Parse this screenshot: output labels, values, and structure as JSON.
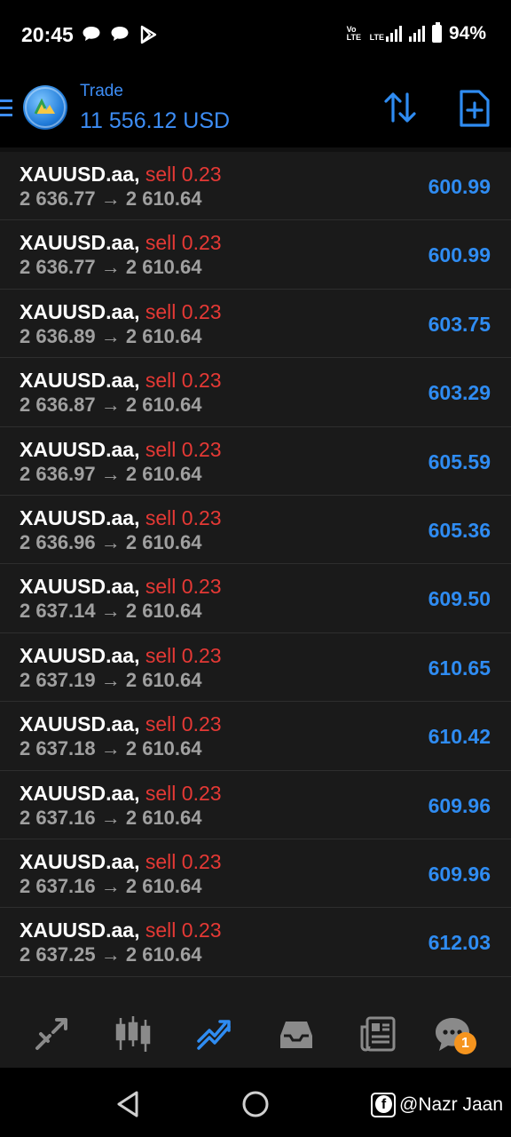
{
  "status_bar": {
    "time": "20:45",
    "volte_label": "Vo LTE",
    "lte_label": "LTE",
    "battery": "94%"
  },
  "header": {
    "title": "Trade",
    "balance": "11 556.12 USD"
  },
  "positions": [
    {
      "symbol": "XAUUSD.aa,",
      "side": "sell 0.23",
      "prices": "2 636.77 → 2 610.64",
      "profit": "600.99"
    },
    {
      "symbol": "XAUUSD.aa,",
      "side": "sell 0.23",
      "prices": "2 636.77 → 2 610.64",
      "profit": "600.99"
    },
    {
      "symbol": "XAUUSD.aa,",
      "side": "sell 0.23",
      "prices": "2 636.89 → 2 610.64",
      "profit": "603.75"
    },
    {
      "symbol": "XAUUSD.aa,",
      "side": "sell 0.23",
      "prices": "2 636.87 → 2 610.64",
      "profit": "603.29"
    },
    {
      "symbol": "XAUUSD.aa,",
      "side": "sell 0.23",
      "prices": "2 636.97 → 2 610.64",
      "profit": "605.59"
    },
    {
      "symbol": "XAUUSD.aa,",
      "side": "sell 0.23",
      "prices": "2 636.96 → 2 610.64",
      "profit": "605.36"
    },
    {
      "symbol": "XAUUSD.aa,",
      "side": "sell 0.23",
      "prices": "2 637.14 → 2 610.64",
      "profit": "609.50"
    },
    {
      "symbol": "XAUUSD.aa,",
      "side": "sell 0.23",
      "prices": "2 637.19 → 2 610.64",
      "profit": "610.65"
    },
    {
      "symbol": "XAUUSD.aa,",
      "side": "sell 0.23",
      "prices": "2 637.18 → 2 610.64",
      "profit": "610.42"
    },
    {
      "symbol": "XAUUSD.aa,",
      "side": "sell 0.23",
      "prices": "2 637.16 → 2 610.64",
      "profit": "609.96"
    },
    {
      "symbol": "XAUUSD.aa,",
      "side": "sell 0.23",
      "prices": "2 637.16 → 2 610.64",
      "profit": "609.96"
    },
    {
      "symbol": "XAUUSD.aa,",
      "side": "sell 0.23",
      "prices": "2 637.25 → 2 610.64",
      "profit": "612.03"
    }
  ],
  "tabs": [
    {
      "icon": "quotes-icon",
      "active": false
    },
    {
      "icon": "chart-icon",
      "active": false
    },
    {
      "icon": "trade-icon",
      "active": true
    },
    {
      "icon": "history-icon",
      "active": false
    },
    {
      "icon": "news-icon",
      "active": false
    },
    {
      "icon": "messages-icon",
      "active": false,
      "badge": "1"
    }
  ],
  "watermark": "@Nazr Jaan",
  "colors": {
    "accent": "#2f8cf2",
    "sell": "#e53935",
    "badge": "#f5941e",
    "list_bg": "#1a1a1a"
  }
}
